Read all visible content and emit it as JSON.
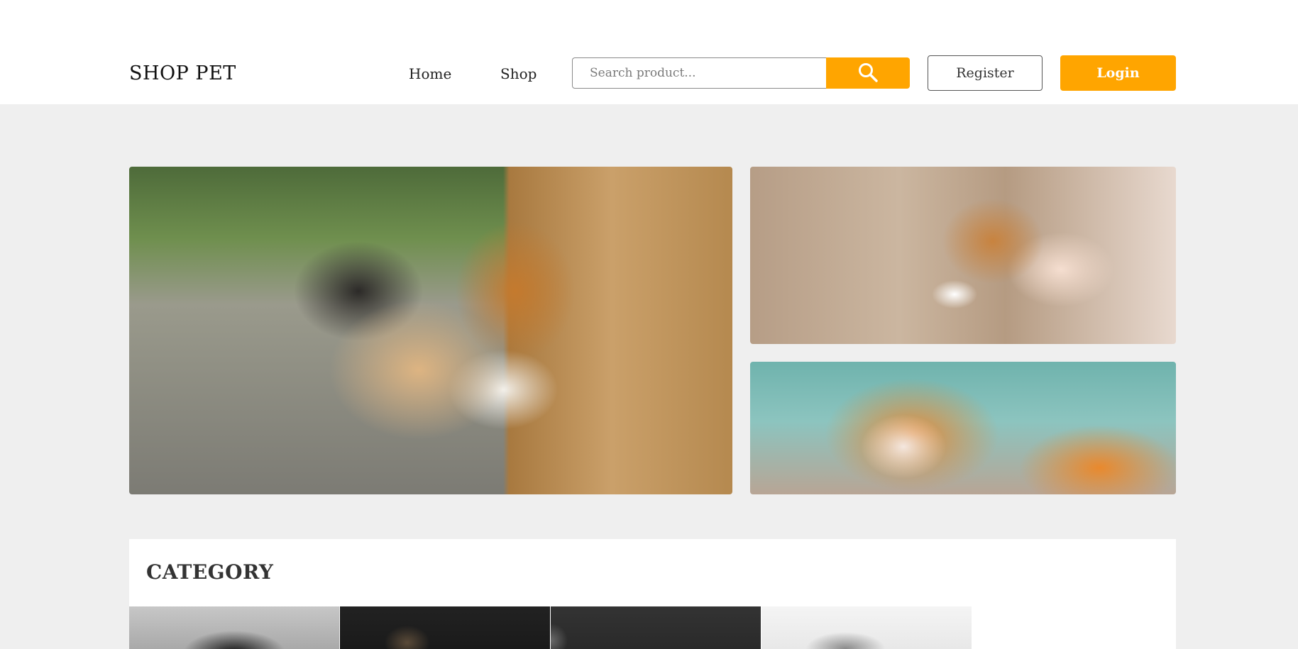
{
  "header": {
    "logo": "SHOP PET",
    "nav": [
      {
        "label": "Home"
      },
      {
        "label": "Shop"
      }
    ],
    "search": {
      "placeholder": "Search product...",
      "value": ""
    },
    "register_label": "Register",
    "login_label": "Login"
  },
  "hero": {
    "images": [
      {
        "icon": "corgi-photo"
      },
      {
        "icon": "hamster-photo"
      },
      {
        "icon": "cat-photo"
      }
    ]
  },
  "category": {
    "title": "CATEGORY",
    "items": [
      {
        "icon": "dog-photo"
      },
      {
        "icon": "pet-photo"
      },
      {
        "icon": "pet-photo"
      },
      {
        "icon": "rabbit-photo"
      }
    ]
  },
  "colors": {
    "accent": "#ffa500",
    "background": "#efefef",
    "header_bg": "#ffffff"
  }
}
